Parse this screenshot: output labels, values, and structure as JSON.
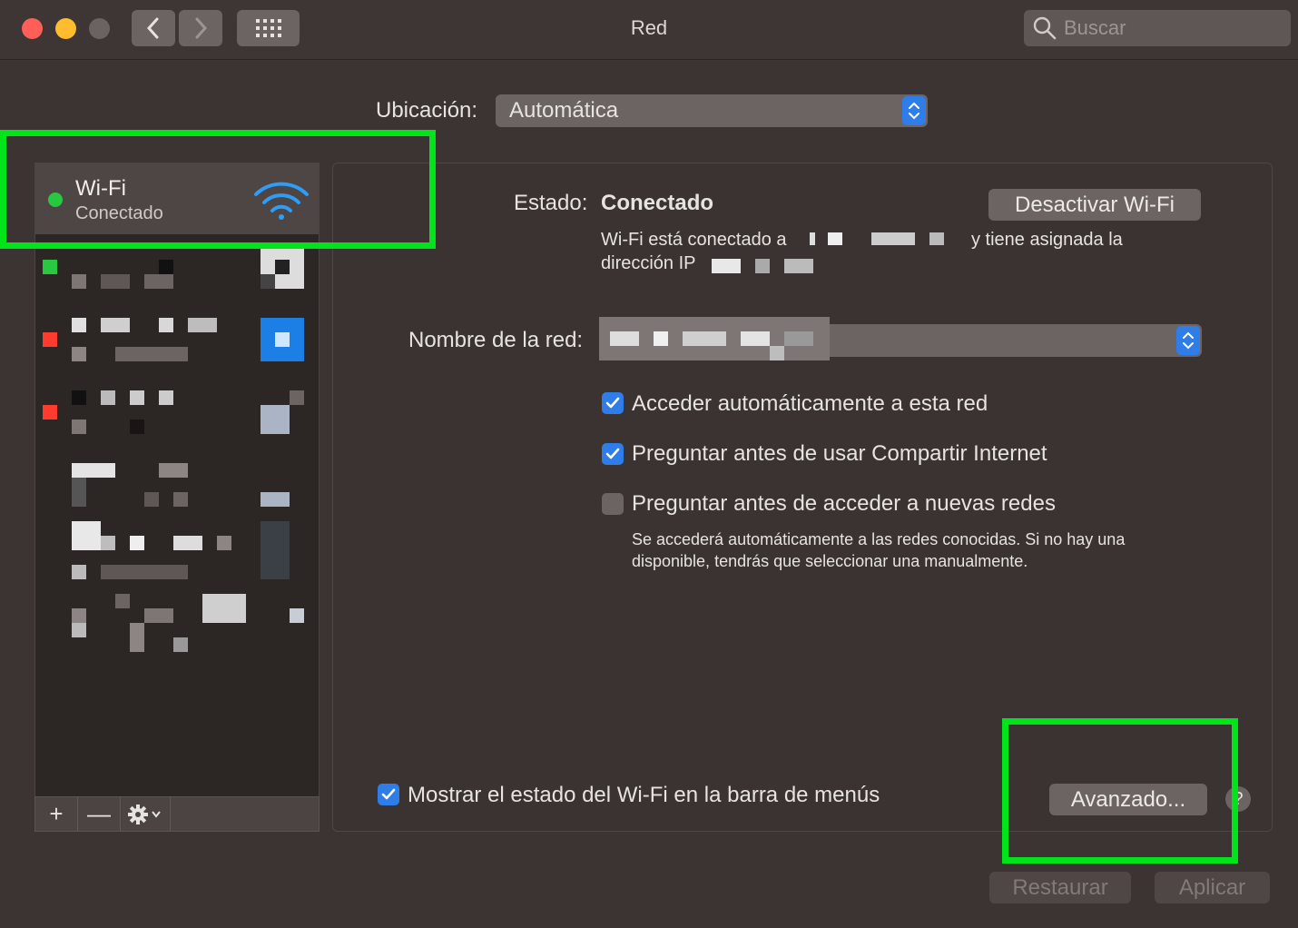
{
  "window": {
    "title": "Red",
    "search_placeholder": "Buscar"
  },
  "location": {
    "label": "Ubicación:",
    "value": "Automática"
  },
  "sidebar": {
    "selected_service": {
      "name": "Wi-Fi",
      "status": "Conectado",
      "status_color": "#28c840"
    },
    "status_colors": [
      "#28c840",
      "#ff3b30",
      "#ff3b30"
    ],
    "footer": {
      "add": "+",
      "remove": "—"
    }
  },
  "detail": {
    "status_label": "Estado:",
    "status_value": "Conectado",
    "toggle_button": "Desactivar Wi-Fi",
    "status_desc_1": "Wi-Fi está conectado a",
    "status_desc_2": "y tiene asignada la",
    "status_desc_3": "dirección IP",
    "network_name_label": "Nombre de la red:",
    "options": [
      {
        "label": "Acceder automáticamente a esta red",
        "checked": true
      },
      {
        "label": "Preguntar antes de usar Compartir Internet",
        "checked": true
      },
      {
        "label": "Preguntar antes de acceder a nuevas redes",
        "checked": false
      }
    ],
    "hint_1": "Se accederá automáticamente a las redes conocidas. Si no hay una",
    "hint_2": "disponible, tendrás que seleccionar una manualmente.",
    "show_in_menubar": {
      "label": "Mostrar el estado del Wi-Fi en la barra de menús",
      "checked": true
    },
    "advanced_button": "Avanzado...",
    "help": "?"
  },
  "actions": {
    "revert": "Restaurar",
    "apply": "Aplicar"
  },
  "colors": {
    "accent": "#2f7de8",
    "highlight": "#00e419"
  }
}
